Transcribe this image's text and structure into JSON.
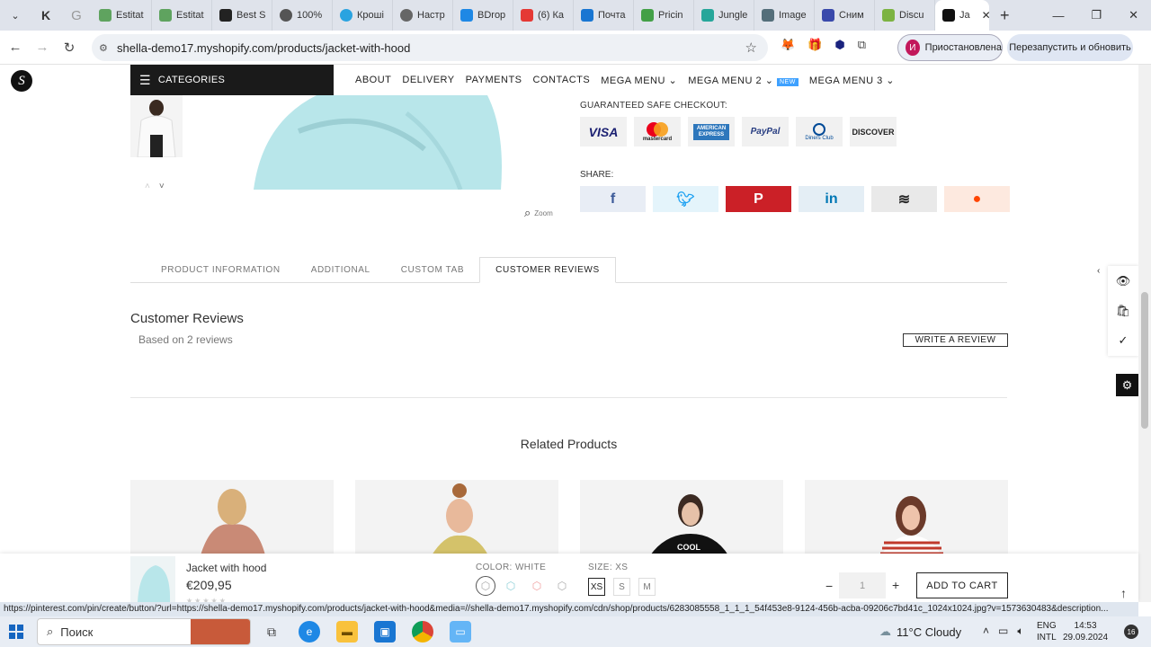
{
  "browser": {
    "tabs": [
      {
        "label": "Estitat",
        "color": "#5fa35f"
      },
      {
        "label": "Estitat",
        "color": "#5fa35f"
      },
      {
        "label": "Best S",
        "color": "#222222"
      },
      {
        "label": "100%",
        "color": "#555555"
      },
      {
        "label": "Кроші",
        "color": "#2aa3e0"
      },
      {
        "label": "Настр",
        "color": "#666666"
      },
      {
        "label": "BDrop",
        "color": "#1e88e5"
      },
      {
        "label": "(6) Ка",
        "color": "#e53935"
      },
      {
        "label": "Почта",
        "color": "#1976d2"
      },
      {
        "label": "Pricin",
        "color": "#43a047"
      },
      {
        "label": "Jungle",
        "color": "#26a69a"
      },
      {
        "label": "Image",
        "color": "#546e7a"
      },
      {
        "label": "Сним",
        "color": "#3949ab"
      },
      {
        "label": "Discu",
        "color": "#7cb342"
      },
      {
        "label": "Ja",
        "color": "#111111"
      }
    ],
    "url": "shella-demo17.myshopify.com/products/jacket-with-hood",
    "profile_label": "Приостановлена",
    "profile_initial": "И",
    "restart_label": "Перезапустить и обновить"
  },
  "header": {
    "categories_label": "CATEGORIES",
    "menu": [
      "ABOUT",
      "DELIVERY",
      "PAYMENTS",
      "CONTACTS",
      "MEGA MENU",
      "MEGA MENU 2",
      "MEGA MENU 3"
    ],
    "new_badge": "NEW"
  },
  "product": {
    "zoom_label": "Zoom",
    "guaranteed_label": "GUARANTEED SAFE CHECKOUT:",
    "payments": [
      "VISA",
      "mastercard",
      "AMERICAN EXPRESS",
      "PayPal",
      "Diners Club",
      "DISCOVER"
    ],
    "share_label": "SHARE:",
    "share_icons": [
      "facebook-icon",
      "twitter-icon",
      "pinterest-icon",
      "linkedin-icon",
      "buffer-icon",
      "reddit-icon"
    ]
  },
  "product_tabs": [
    "PRODUCT INFORMATION",
    "ADDITIONAL",
    "CUSTOM TAB",
    "CUSTOMER REVIEWS"
  ],
  "reviews": {
    "title": "Customer Reviews",
    "based_on": "Based on 2 reviews",
    "write_label": "WRITE A REVIEW"
  },
  "related_title": "Related Products",
  "sticky": {
    "name": "Jacket with hood",
    "price": "€209,95",
    "color_label": "COLOR:",
    "color_value": "WHITE",
    "size_label": "SIZE:",
    "size_value": "XS",
    "sizes": [
      "XS",
      "S",
      "M"
    ],
    "qty": "1",
    "add_label": "ADD TO CART"
  },
  "status_url": "https://pinterest.com/pin/create/button/?url=https://shella-demo17.myshopify.com/products/jacket-with-hood&media=//shella-demo17.myshopify.com/cdn/shop/products/6283085558_1_1_1_54f453e8-9124-456b-acba-09206c7bd41c_1024x1024.jpg?v=1573630483&description...",
  "taskbar": {
    "search_label": "Поиск",
    "weather": "11°C  Cloudy",
    "lang_top": "ENG",
    "lang_bottom": "INTL",
    "time": "14:53",
    "date": "29.09.2024",
    "notif": "16"
  }
}
